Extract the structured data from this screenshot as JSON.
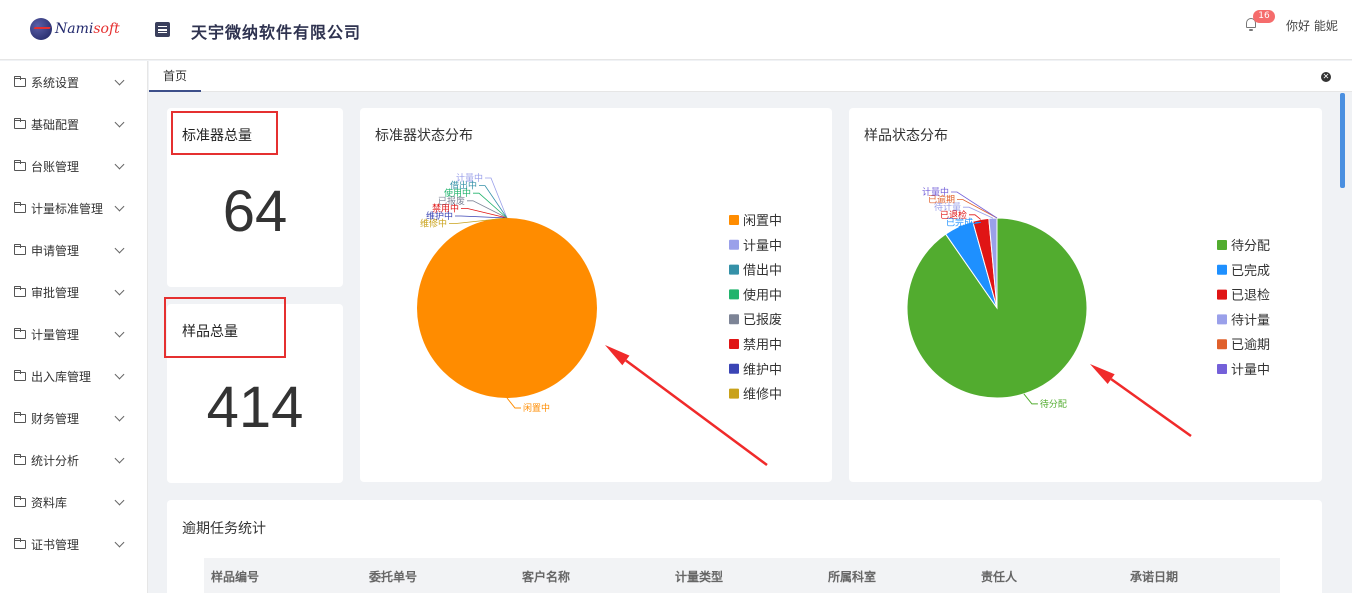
{
  "header": {
    "logo_main": "Nami",
    "logo_accent": "soft",
    "company": "天宇微纳软件有限公司",
    "notification_count": "16",
    "greeting": "你好 能妮"
  },
  "sidebar": {
    "items": [
      {
        "label": "系统设置"
      },
      {
        "label": "基础配置"
      },
      {
        "label": "台账管理"
      },
      {
        "label": "计量标准管理"
      },
      {
        "label": "申请管理"
      },
      {
        "label": "审批管理"
      },
      {
        "label": "计量管理"
      },
      {
        "label": "出入库管理"
      },
      {
        "label": "财务管理"
      },
      {
        "label": "统计分析"
      },
      {
        "label": "资料库"
      },
      {
        "label": "证书管理"
      }
    ]
  },
  "tabs": {
    "home": "首页"
  },
  "stats": {
    "standards_title": "标准器总量",
    "standards_value": "64",
    "samples_title": "样品总量",
    "samples_value": "414"
  },
  "charts": {
    "standards_title": "标准器状态分布",
    "samples_title": "样品状态分布"
  },
  "chart_data": [
    {
      "type": "pie",
      "title": "标准器状态分布",
      "legend_position": "right",
      "categories": [
        "闲置中",
        "计量中",
        "借出中",
        "使用中",
        "已报废",
        "禁用中",
        "维护中",
        "维修中"
      ],
      "values": [
        64,
        0,
        0,
        0,
        0,
        0,
        0,
        0
      ],
      "colors": [
        "#ff8c00",
        "#9aa0ea",
        "#3591a8",
        "#22b46d",
        "#7d8496",
        "#e01515",
        "#3b45b5",
        "#c9a21b"
      ]
    },
    {
      "type": "pie",
      "title": "样品状态分布",
      "legend_position": "right",
      "categories": [
        "待分配",
        "已完成",
        "已退检",
        "待计量",
        "已逾期",
        "计量中"
      ],
      "values": [
        374,
        22,
        12,
        6,
        0,
        0
      ],
      "colors": [
        "#52ac2f",
        "#1e90ff",
        "#e01515",
        "#9aa0ea",
        "#e0602b",
        "#7460d9"
      ]
    }
  ],
  "overdue": {
    "title": "逾期任务统计",
    "columns": [
      "样品编号",
      "委托单号",
      "客户名称",
      "计量类型",
      "所属科室",
      "责任人",
      "承诺日期"
    ]
  }
}
